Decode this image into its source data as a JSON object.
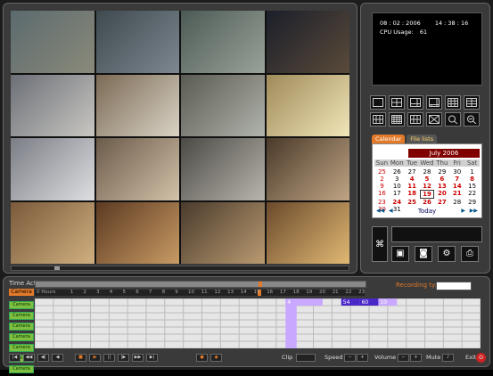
{
  "info": {
    "date": "08 : 02 : 2006",
    "time": "14 : 38 : 16",
    "cpu_label": "CPU Usage:",
    "cpu_value": "61"
  },
  "cameras": [
    {
      "label": "",
      "palette": [
        "#5b6a6e",
        "#8a8a7a"
      ]
    },
    {
      "label": "",
      "palette": [
        "#3f4a4f",
        "#7d8790"
      ]
    },
    {
      "label": "",
      "palette": [
        "#4c5a55",
        "#9aa39a"
      ]
    },
    {
      "label": "",
      "palette": [
        "#1b1f2a",
        "#5a4a3a"
      ]
    },
    {
      "label": "",
      "palette": [
        "#6b6f76",
        "#c9c7c2"
      ]
    },
    {
      "label": "",
      "palette": [
        "#7b6a55",
        "#d9d3c5"
      ]
    },
    {
      "label": "",
      "palette": [
        "#5a5b52",
        "#b1b4ac"
      ]
    },
    {
      "label": "",
      "palette": [
        "#a08a5a",
        "#f0e6b8"
      ]
    },
    {
      "label": "",
      "palette": [
        "#7a7d84",
        "#dedfe2"
      ]
    },
    {
      "label": "",
      "palette": [
        "#6b5b4a",
        "#d2c2a9"
      ]
    },
    {
      "label": "",
      "palette": [
        "#4b4a45",
        "#b8b5ac"
      ]
    },
    {
      "label": "",
      "palette": [
        "#4a3a2a",
        "#c0a585"
      ]
    },
    {
      "label": "",
      "palette": [
        "#7a5a3a",
        "#d0b080"
      ]
    },
    {
      "label": "",
      "palette": [
        "#5c3a22",
        "#c89b64"
      ]
    },
    {
      "label": "",
      "palette": [
        "#4a3b2c",
        "#b99a71"
      ]
    },
    {
      "label": "",
      "palette": [
        "#6b4a2c",
        "#e0b874"
      ]
    }
  ],
  "tabs": [
    "Calendar",
    "File lists"
  ],
  "calendar": {
    "month": "July 2006",
    "weekdays": [
      "Sun",
      "Mon",
      "Tue",
      "Wed",
      "Thu",
      "Fri",
      "Sat"
    ],
    "days": [
      [
        "25",
        "26",
        "27",
        "28",
        "29",
        "30",
        "1"
      ],
      [
        "2",
        "3",
        "4",
        "5",
        "6",
        "7",
        "8"
      ],
      [
        "9",
        "10",
        "11",
        "12",
        "13",
        "14",
        "15"
      ],
      [
        "16",
        "17",
        "18",
        "19",
        "20",
        "21",
        "22"
      ],
      [
        "23",
        "24",
        "25",
        "26",
        "27",
        "28",
        "29"
      ],
      [
        "30",
        "31",
        "",
        "",
        "",
        "",
        ""
      ]
    ],
    "highlight": [
      "4",
      "5",
      "6",
      "7",
      "8",
      "11",
      "12",
      "13",
      "14",
      "18",
      "19",
      "20",
      "21",
      "24",
      "25",
      "26",
      "27"
    ],
    "today_label": "Today"
  },
  "timeline": {
    "time_act_label": "Time Act",
    "camera_label": "Camera",
    "hours_label": "0 Hours",
    "hour_ticks": [
      "1",
      "2",
      "3",
      "4",
      "5",
      "6",
      "7",
      "8",
      "9",
      "10",
      "11",
      "12",
      "13",
      "14",
      "15",
      "16",
      "17",
      "18",
      "19",
      "20",
      "21",
      "22",
      "23"
    ],
    "recording_type_label": "Recording type",
    "camera_rows": [
      "Camera",
      "Camera",
      "Camera",
      "Camera",
      "Camera",
      "Camera",
      "Camera"
    ],
    "blocks": [
      {
        "label": "4",
        "start": 13.5,
        "end": 15.5,
        "row": 0,
        "color": "#c9a8ff"
      },
      {
        "label": "54",
        "start": 16.5,
        "end": 17.5,
        "row": 0,
        "color": "#4a28c8"
      },
      {
        "label": "60",
        "start": 17.5,
        "end": 18.5,
        "row": 0,
        "color": "#4a28c8"
      },
      {
        "label": "10",
        "start": 18.5,
        "end": 19.5,
        "row": 0,
        "color": "#c9a8ff"
      }
    ],
    "activity_column": 13.5
  },
  "controls": {
    "clip_label": "Clip",
    "speed_label": "Speed",
    "volume_label": "Volume",
    "mute_label": "Mute",
    "exit_label": "Exit"
  }
}
